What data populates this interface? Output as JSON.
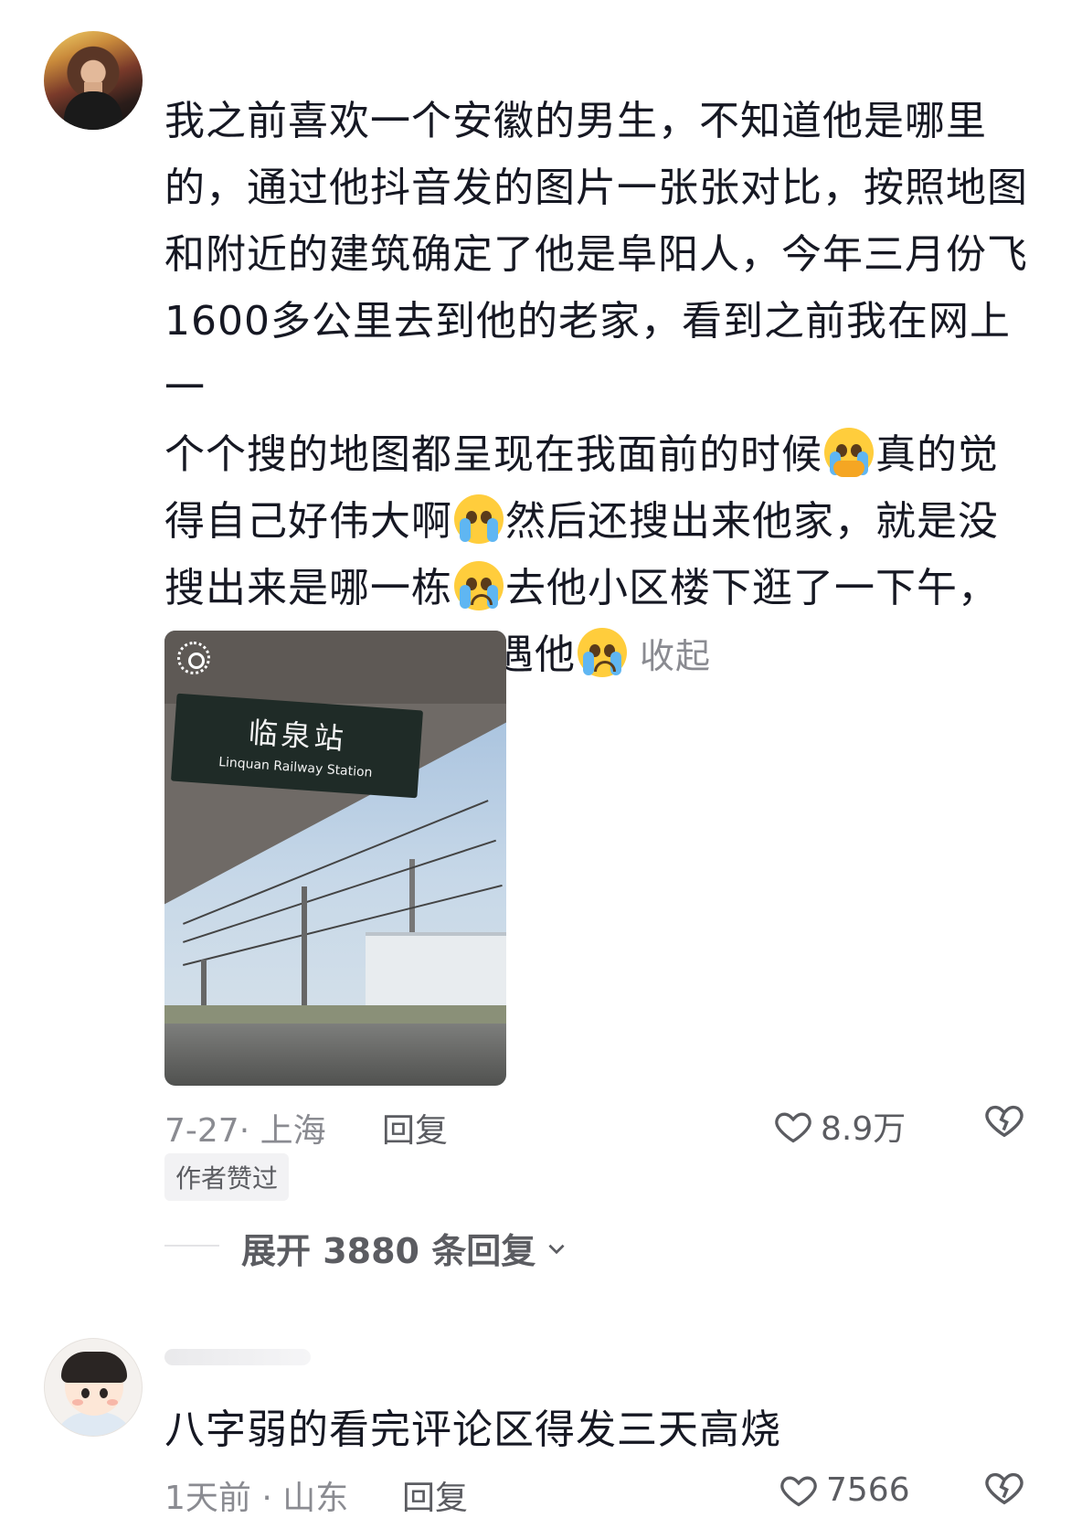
{
  "comment1": {
    "lines": [
      "我之前喜欢一个安徽的男生，不知道他是哪里",
      "的，通过他抖音发的图片一张张对比，按照地图",
      "和附近的建筑确定了他是阜阳人，今年三月份飞",
      "1600多公里去到他的老家，看到之前我在网上一",
      "个个搜的地图都呈现在我面前的时候",
      "真的觉",
      "得自己好伟大啊",
      "然后还搜出来他家，就是没",
      "搜出来是哪一栋",
      "去他小区楼下逛了一下午，",
      "希望有机会可以偶遇他"
    ],
    "collapse_label": "收起",
    "photo": {
      "sign_zh": "临泉站",
      "sign_en": "Linquan Railway Station"
    },
    "date_location": "7-27· 上海",
    "reply_label": "回复",
    "like_count": "8.9万",
    "author_badge": "作者赞过",
    "expand_replies": "展开 3880 条回复"
  },
  "comment2": {
    "text": "八字弱的看完评论区得发三天高烧",
    "date_location": "1天前 · 山东",
    "reply_label": "回复",
    "like_count": "7566"
  },
  "icons": {
    "like": "heart-outline-icon",
    "dislike": "broken-heart-icon",
    "expand": "chevron-down-icon",
    "live_photo": "live-photo-icon"
  }
}
